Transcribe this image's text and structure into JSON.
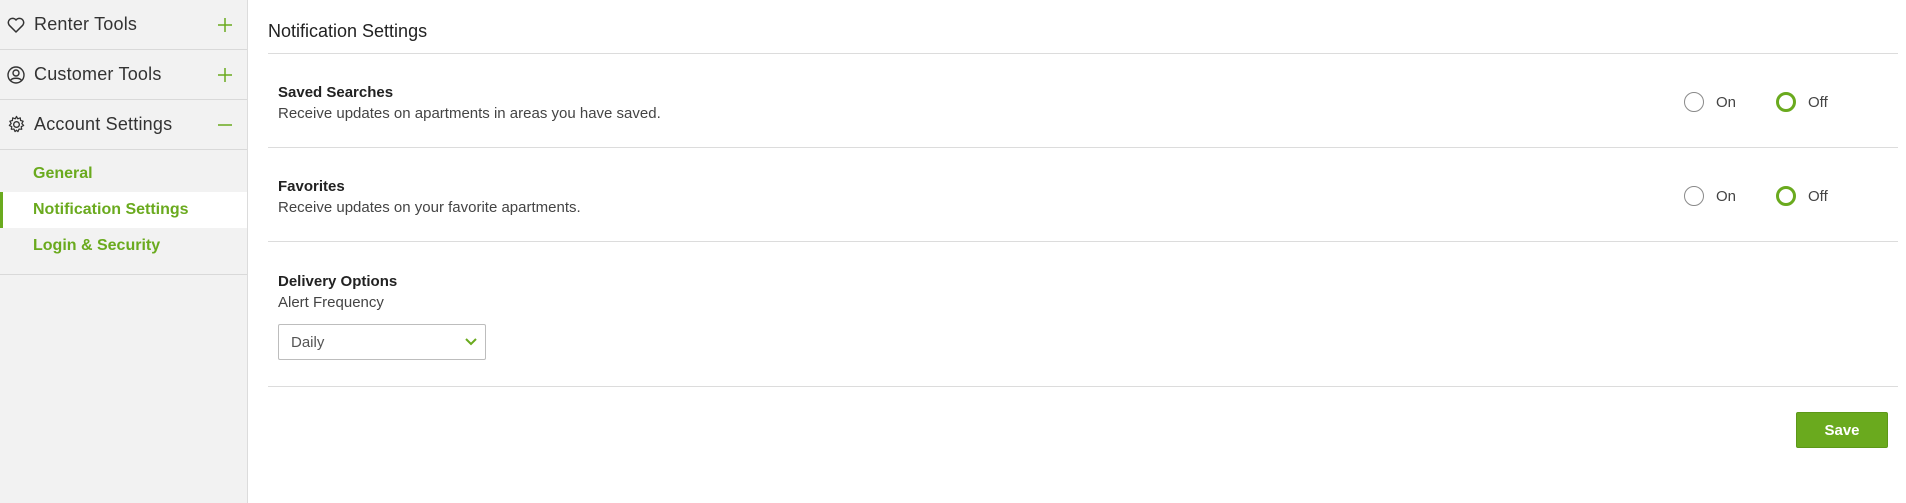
{
  "sidebar": {
    "sections": [
      {
        "label": "Renter Tools",
        "icon": "heart-icon",
        "toggle": "plus-icon"
      },
      {
        "label": "Customer Tools",
        "icon": "user-circle-icon",
        "toggle": "plus-icon"
      },
      {
        "label": "Account Settings",
        "icon": "gear-icon",
        "toggle": "minus-icon"
      }
    ],
    "subitems": [
      "General",
      "Notification Settings",
      "Login & Security"
    ],
    "active_subitem": "Notification Settings"
  },
  "main": {
    "title": "Notification Settings",
    "settings": [
      {
        "title": "Saved Searches",
        "description": "Receive updates on apartments in areas you have saved.",
        "on_label": "On",
        "off_label": "Off",
        "selected": "Off"
      },
      {
        "title": "Favorites",
        "description": "Receive updates on your favorite apartments.",
        "on_label": "On",
        "off_label": "Off",
        "selected": "Off"
      }
    ],
    "delivery": {
      "title": "Delivery Options",
      "subtitle": "Alert Frequency",
      "select_value": "Daily"
    },
    "save_label": "Save"
  },
  "colors": {
    "accent": "#6aaa1e",
    "sidebar_bg": "#f2f2f2",
    "divider": "#dcdcdc"
  }
}
